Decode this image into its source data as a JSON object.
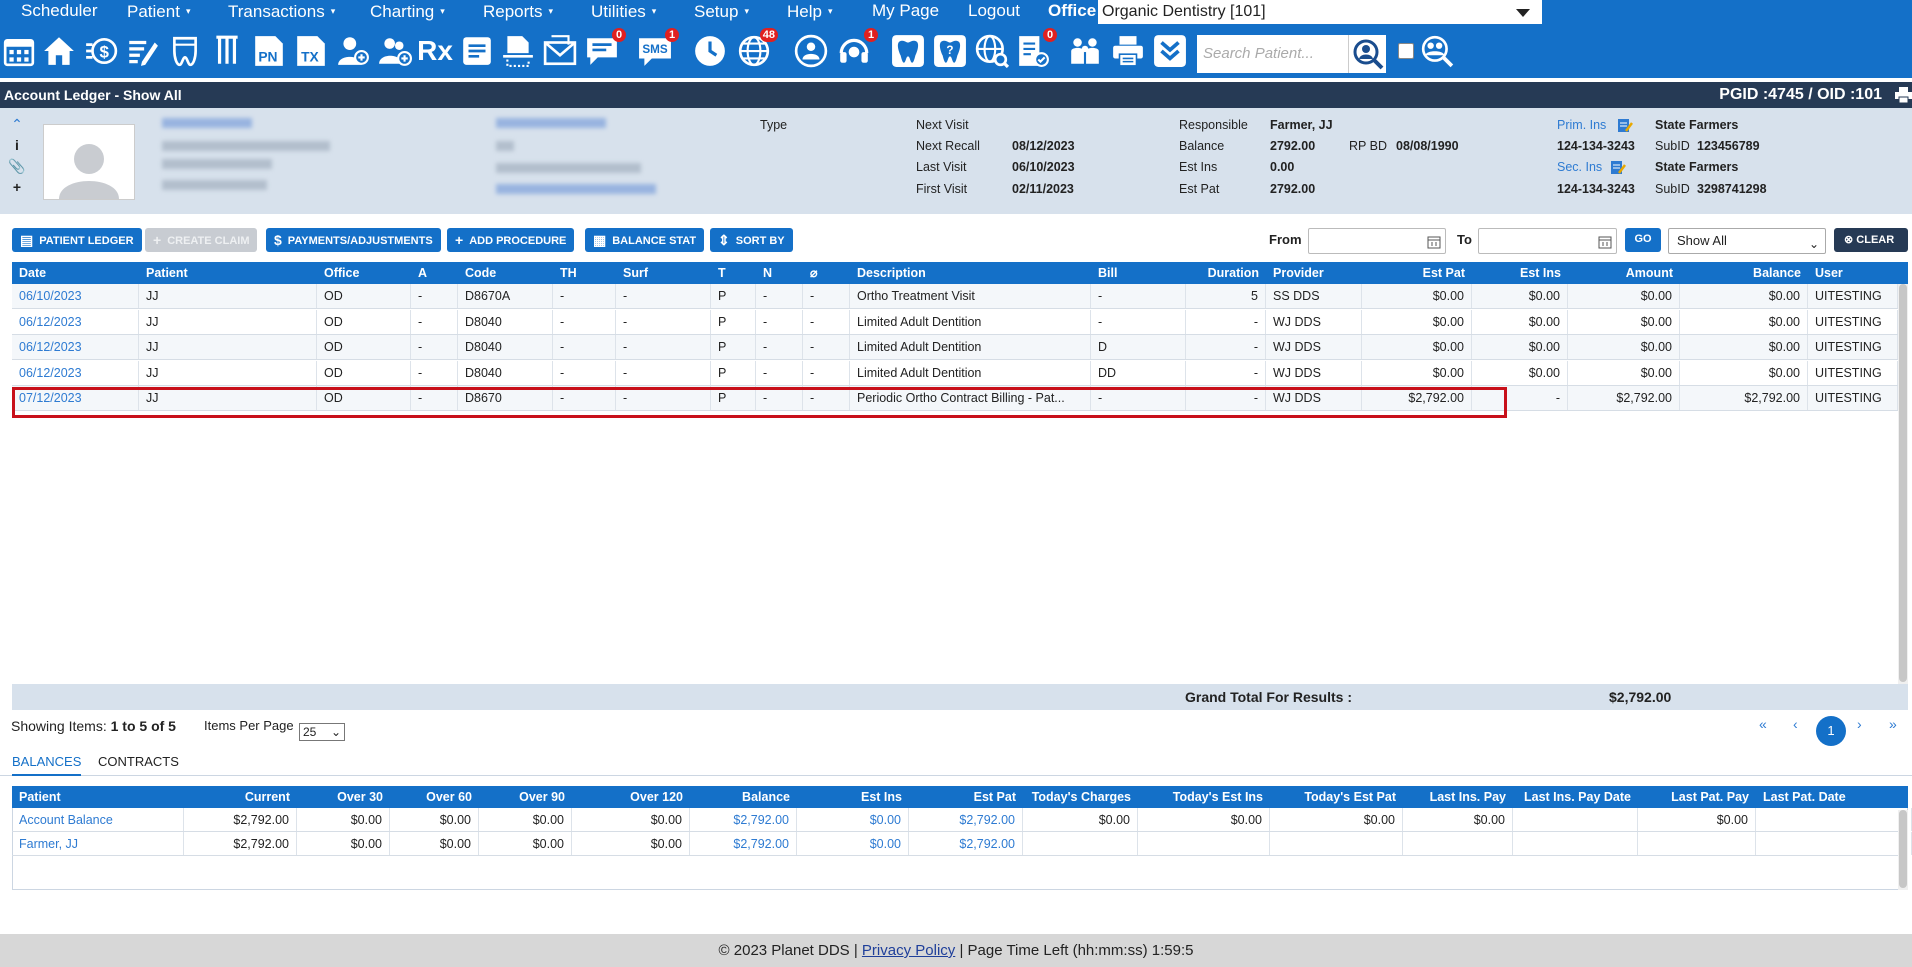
{
  "topnav": {
    "scheduler": "Scheduler",
    "patient": "Patient",
    "transactions": "Transactions",
    "charting": "Charting",
    "reports": "Reports",
    "utilities": "Utilities",
    "setup": "Setup",
    "help": "Help",
    "mypage": "My Page",
    "logout": "Logout",
    "office_label": "Office",
    "office_value": "Organic Dentistry [101]",
    "caret": "▾"
  },
  "iconbar": {
    "search_placeholder": "Search Patient...",
    "badge_messages": "0",
    "badge_sms": "1",
    "badge_globe": "48",
    "badge_support": "1",
    "badge_checklist": "0",
    "label_pn": "PN",
    "label_tx": "TX",
    "label_rx": "Rx",
    "label_sms": "SMS"
  },
  "title": {
    "left": "Account Ledger - Show All",
    "right": "PGID :4745  /  OID :101"
  },
  "patient": {
    "type_label": "Type",
    "next_visit_label": "Next Visit",
    "next_recall_label": "Next Recall",
    "next_recall": "08/12/2023",
    "last_visit_label": "Last Visit",
    "last_visit": "06/10/2023",
    "first_visit_label": "First Visit",
    "first_visit": "02/11/2023",
    "responsible_label": "Responsible",
    "responsible": "Farmer, JJ",
    "balance_label": "Balance",
    "balance": "2792.00",
    "rpbd_label": "RP BD",
    "rpbd": "08/08/1990",
    "est_ins_label": "Est Ins",
    "est_ins": "0.00",
    "est_pat_label": "Est Pat",
    "est_pat": "2792.00",
    "prim_ins_label": "Prim. Ins",
    "prim_ins": "State Farmers",
    "prim_id": "124-134-3243",
    "prim_subid_label": "SubID",
    "prim_subid": "123456789",
    "sec_ins_label": "Sec. Ins",
    "sec_ins": "State Farmers",
    "sec_id": "124-134-3243",
    "sec_subid_label": "SubID",
    "sec_subid": "3298741298"
  },
  "toolbar": {
    "patient_ledger": "PATIENT LEDGER",
    "create_claim": "CREATE CLAIM",
    "payments": "PAYMENTS/ADJUSTMENTS",
    "add_procedure": "ADD PROCEDURE",
    "balance_stat": "BALANCE STAT",
    "sort_by": "SORT BY",
    "from_label": "From",
    "to_label": "To",
    "go": "GO",
    "filter_value": "Show All",
    "clear": "CLEAR"
  },
  "ledger": {
    "columns": [
      "Date",
      "Patient",
      "Office",
      "A",
      "Code",
      "TH",
      "Surf",
      "T",
      "N",
      "",
      "Description",
      "Bill",
      "Duration",
      "Provider",
      "Est Pat",
      "Est Ins",
      "Amount",
      "Balance",
      "User"
    ],
    "rows": [
      [
        "06/10/2023",
        "JJ",
        "OD",
        "-",
        "D8670A",
        "-",
        "-",
        "P",
        "-",
        "-",
        "Ortho Treatment Visit",
        "-",
        "5",
        "SS DDS",
        "$0.00",
        "$0.00",
        "$0.00",
        "$0.00",
        "UITESTING"
      ],
      [
        "06/12/2023",
        "JJ",
        "OD",
        "-",
        "D8040",
        "-",
        "-",
        "P",
        "-",
        "-",
        "Limited Adult Dentition",
        "-",
        "-",
        "WJ DDS",
        "$0.00",
        "$0.00",
        "$0.00",
        "$0.00",
        "UITESTING"
      ],
      [
        "06/12/2023",
        "JJ",
        "OD",
        "-",
        "D8040",
        "-",
        "-",
        "P",
        "-",
        "-",
        "Limited Adult Dentition",
        "D",
        "-",
        "WJ DDS",
        "$0.00",
        "$0.00",
        "$0.00",
        "$0.00",
        "UITESTING"
      ],
      [
        "06/12/2023",
        "JJ",
        "OD",
        "-",
        "D8040",
        "-",
        "-",
        "P",
        "-",
        "-",
        "Limited Adult Dentition",
        "DD",
        "-",
        "WJ DDS",
        "$0.00",
        "$0.00",
        "$0.00",
        "$0.00",
        "UITESTING"
      ],
      [
        "07/12/2023",
        "JJ",
        "OD",
        "-",
        "D8670",
        "-",
        "-",
        "P",
        "-",
        "-",
        "Periodic Ortho Contract Billing - Pat...",
        "-",
        "-",
        "WJ DDS",
        "$2,792.00",
        "-",
        "$2,792.00",
        "$2,792.00",
        "UITESTING"
      ]
    ],
    "grand_total_label": "Grand Total For Results :",
    "grand_total": "$2,792.00"
  },
  "paging": {
    "showing_label": "Showing Items:",
    "showing_value": "1 to 5 of 5",
    "per_page_label": "Items Per Page",
    "per_page": "25",
    "first": "«",
    "prev": "‹",
    "current": "1",
    "next": "›",
    "last": "»"
  },
  "tabs": {
    "balances": "BALANCES",
    "contracts": "CONTRACTS"
  },
  "balances": {
    "columns": [
      "Patient",
      "Current",
      "Over 30",
      "Over 60",
      "Over 90",
      "Over 120",
      "Balance",
      "Est Ins",
      "Est Pat",
      "Today's Charges",
      "Today's Est Ins",
      "Today's Est Pat",
      "Last Ins. Pay",
      "Last Ins. Pay Date",
      "Last Pat. Pay",
      "Last Pat. Date"
    ],
    "rows": [
      [
        "Account Balance",
        "$2,792.00",
        "$0.00",
        "$0.00",
        "$0.00",
        "$0.00",
        "$2,792.00",
        "$0.00",
        "$2,792.00",
        "$0.00",
        "$0.00",
        "$0.00",
        "$0.00",
        "",
        "$0.00",
        ""
      ],
      [
        "Farmer, JJ",
        "$2,792.00",
        "$0.00",
        "$0.00",
        "$0.00",
        "$0.00",
        "$2,792.00",
        "$0.00",
        "$2,792.00",
        "",
        "",
        "",
        "",
        "",
        "",
        ""
      ]
    ]
  },
  "footer": {
    "copyright": "© 2023 Planet DDS |",
    "privacy": "Privacy Policy",
    "time_left": "|  Page Time Left (hh:mm:ss) 1:59:5"
  }
}
